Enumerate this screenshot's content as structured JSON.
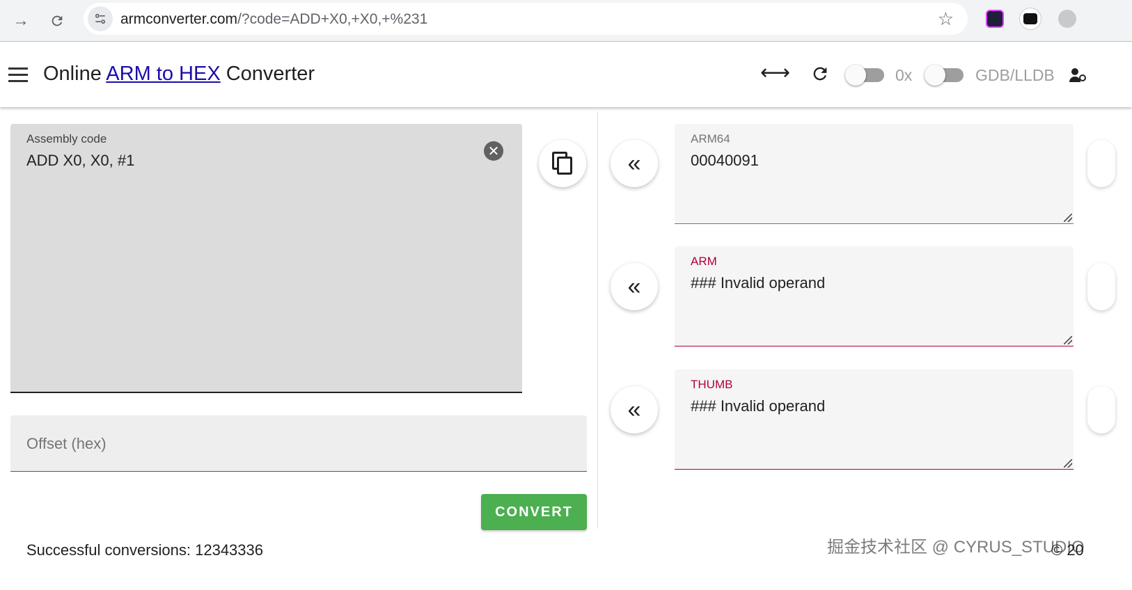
{
  "browser": {
    "back_icon": "arrow-right-icon",
    "reload_icon": "reload-icon",
    "url_host": "armconverter.com",
    "url_rest": "/?code=ADD+X0,+X0,+%231",
    "bookmark_icon": "star-icon"
  },
  "appbar": {
    "title_prefix": "Online ",
    "title_link": "ARM to HEX",
    "title_suffix": " Converter",
    "swap_icon": "left-right-arrow-icon",
    "refresh_icon": "refresh-icon",
    "toggle_0x_label": "0x",
    "toggle_gdb_label": "GDB/LLDB"
  },
  "assembly": {
    "label": "Assembly code",
    "value": "ADD X0, X0, #1"
  },
  "offset": {
    "placeholder": "Offset (hex)"
  },
  "convert_label": "CONVERT",
  "outputs": [
    {
      "label": "ARM64",
      "value": "00040091",
      "label_color": "#757575"
    },
    {
      "label": "ARM",
      "value": "### Invalid operand",
      "label_color": "#b0003a"
    },
    {
      "label": "THUMB",
      "value": "### Invalid operand",
      "label_color": "#b0003a"
    }
  ],
  "footer": {
    "count_text": "Successful conversions: 12343336",
    "watermark": "掘金技术社区 @ CYRUS_STUDIO",
    "copyright": "© 20"
  }
}
